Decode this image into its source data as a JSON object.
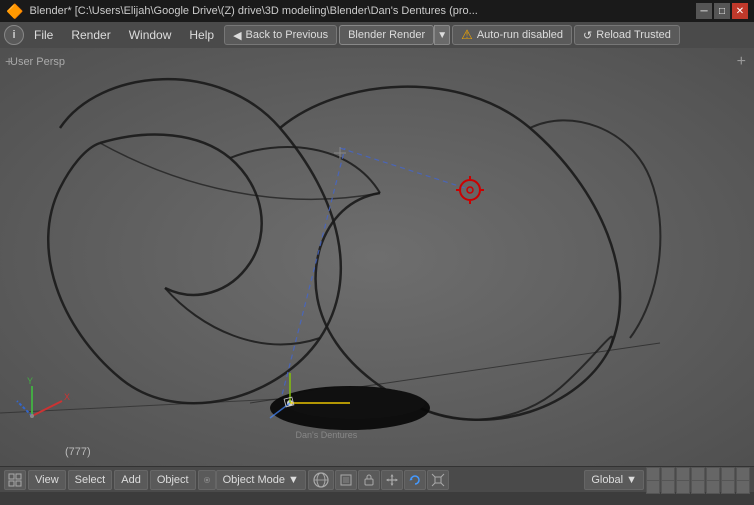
{
  "titlebar": {
    "text": "Blender* [C:\\Users\\Elijah\\Google Drive\\(Z) drive\\3D modeling\\Blender\\Dan's Dentures (pro...",
    "icon": "🔶"
  },
  "menubar": {
    "info_label": "i",
    "file_label": "File",
    "render_label": "Render",
    "window_label": "Window",
    "help_label": "Help",
    "back_button": "Back to Previous",
    "render_engine": "Blender Render",
    "autorun_label": "Auto-run disabled",
    "reload_button": "Reload Trusted"
  },
  "viewport": {
    "label": "User Persp",
    "frame_counter": "(777)"
  },
  "bottombar": {
    "view_label": "View",
    "select_label": "Select",
    "add_label": "Add",
    "object_label": "Object",
    "mode_label": "Object Mode",
    "global_label": "Global"
  }
}
